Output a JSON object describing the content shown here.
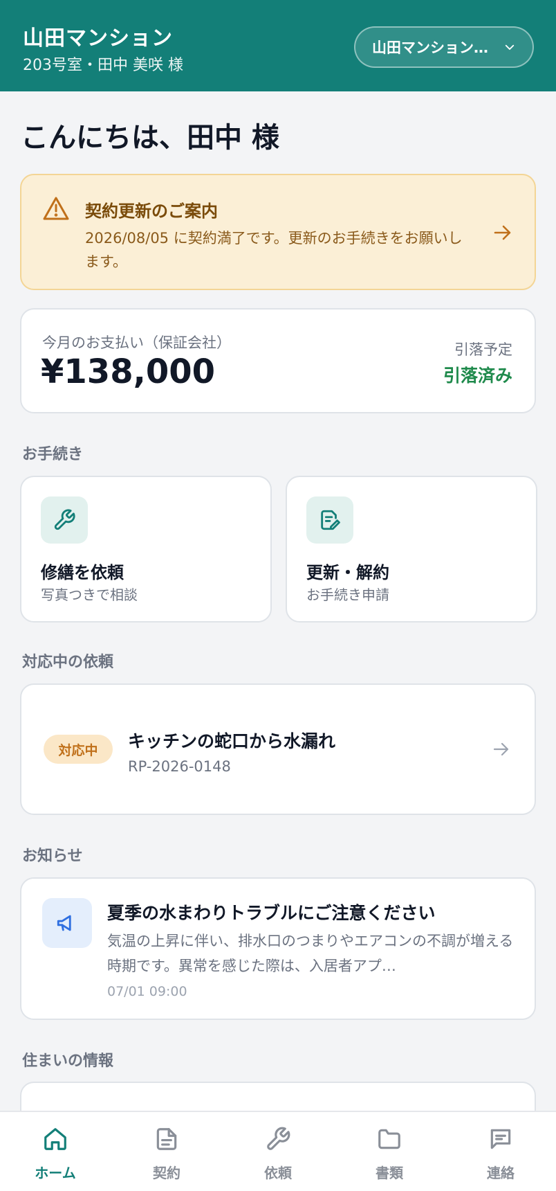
{
  "header": {
    "title": "山田マンション",
    "subtitle": "203号室・田中 美咲 様",
    "property_select": "山田マンション…"
  },
  "greeting": "こんにちは、田中 様",
  "alert": {
    "title": "契約更新のご案内",
    "body": "2026/08/05 に契約満了です。更新のお手続きをお願いします。"
  },
  "payment": {
    "label": "今月のお支払い（保証会社）",
    "amount": "¥138,000",
    "schedule_label": "引落予定",
    "status": "引落済み"
  },
  "sections": {
    "procedures": "お手続き",
    "active_requests": "対応中の依頼",
    "notices": "お知らせ",
    "home_info": "住まいの情報"
  },
  "actions": [
    {
      "title": "修繕を依頼",
      "subtitle": "写真つきで相談",
      "icon": "wrench-icon"
    },
    {
      "title": "更新・解約",
      "subtitle": "お手続き申請",
      "icon": "document-edit-icon"
    }
  ],
  "request": {
    "badge": "対応中",
    "title": "キッチンの蛇口から水漏れ",
    "id": "RP-2026-0148"
  },
  "notice": {
    "title": "夏季の水まわりトラブルにご注意ください",
    "body": "気温の上昇に伴い、排水口のつまりやエアコンの不調が増える時期です。異常を感じた際は、入居者アプ…",
    "time": "07/01 09:00",
    "icon": "megaphone-icon"
  },
  "nav": [
    {
      "label": "ホーム",
      "icon": "home-icon",
      "active": true
    },
    {
      "label": "契約",
      "icon": "document-icon",
      "active": false
    },
    {
      "label": "依頼",
      "icon": "wrench-icon",
      "active": false
    },
    {
      "label": "書類",
      "icon": "folder-icon",
      "active": false
    },
    {
      "label": "連絡",
      "icon": "chat-icon",
      "active": false
    }
  ],
  "colors": {
    "brand": "#137f78",
    "alert_bg": "#fbefd6",
    "alert_text": "#7a4b0a",
    "status_green": "#1f8a4c",
    "badge_bg": "#fbe7c7",
    "badge_text": "#c0701a",
    "page_bg": "#f3f4f6"
  }
}
